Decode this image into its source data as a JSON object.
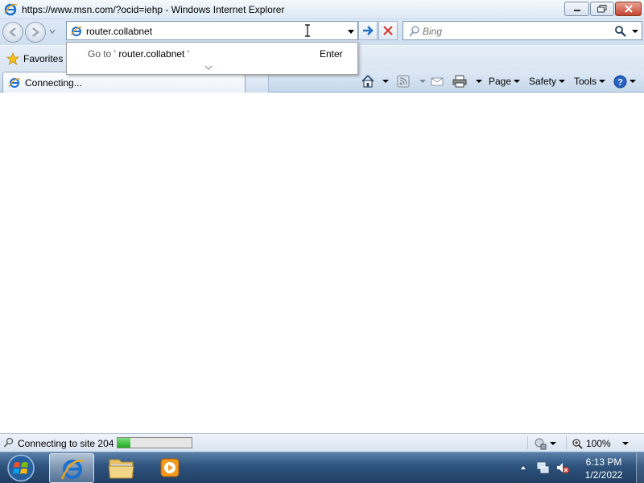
{
  "window": {
    "title": "https://www.msn.com/?ocid=iehp - Windows Internet Explorer",
    "minimize_icon": "minimize-icon",
    "maximize_icon": "restore-icon",
    "close_icon": "close-icon"
  },
  "navbar": {
    "back_icon": "back-arrow-icon",
    "forward_icon": "forward-arrow-icon",
    "address_value": "router.collabnet",
    "go_icon": "go-arrow-icon",
    "stop_icon": "stop-icon",
    "search_placeholder": "Bing",
    "search_icon": "magnifier-icon"
  },
  "autocomplete": {
    "prefix": "Go to '",
    "term": "router.collabnet",
    "suffix": "'",
    "hint": "Enter"
  },
  "favorites": {
    "label": "Favorites"
  },
  "tab": {
    "label": "Connecting..."
  },
  "commandbar": {
    "home_icon": "home-icon",
    "feeds_icon": "rss-feed-icon",
    "mail_icon": "read-mail-icon",
    "print_icon": "printer-icon",
    "page_label": "Page",
    "safety_label": "Safety",
    "tools_label": "Tools",
    "help_icon": "help-icon"
  },
  "statusbar": {
    "text": "Connecting to site 204",
    "progress": 0.17,
    "zoom": "100%"
  },
  "taskbar": {
    "clock_time": "6:13 PM",
    "clock_date": "1/2/2022",
    "apps": [
      "internet-explorer",
      "windows-explorer",
      "windows-media-player"
    ]
  },
  "colors": {
    "titlebar": "#dde9f5",
    "taskbar": "#2d527c",
    "progress_fill": "#1fa81f",
    "ie_blue": "#1b6fd1",
    "close_red": "#c3452f"
  }
}
